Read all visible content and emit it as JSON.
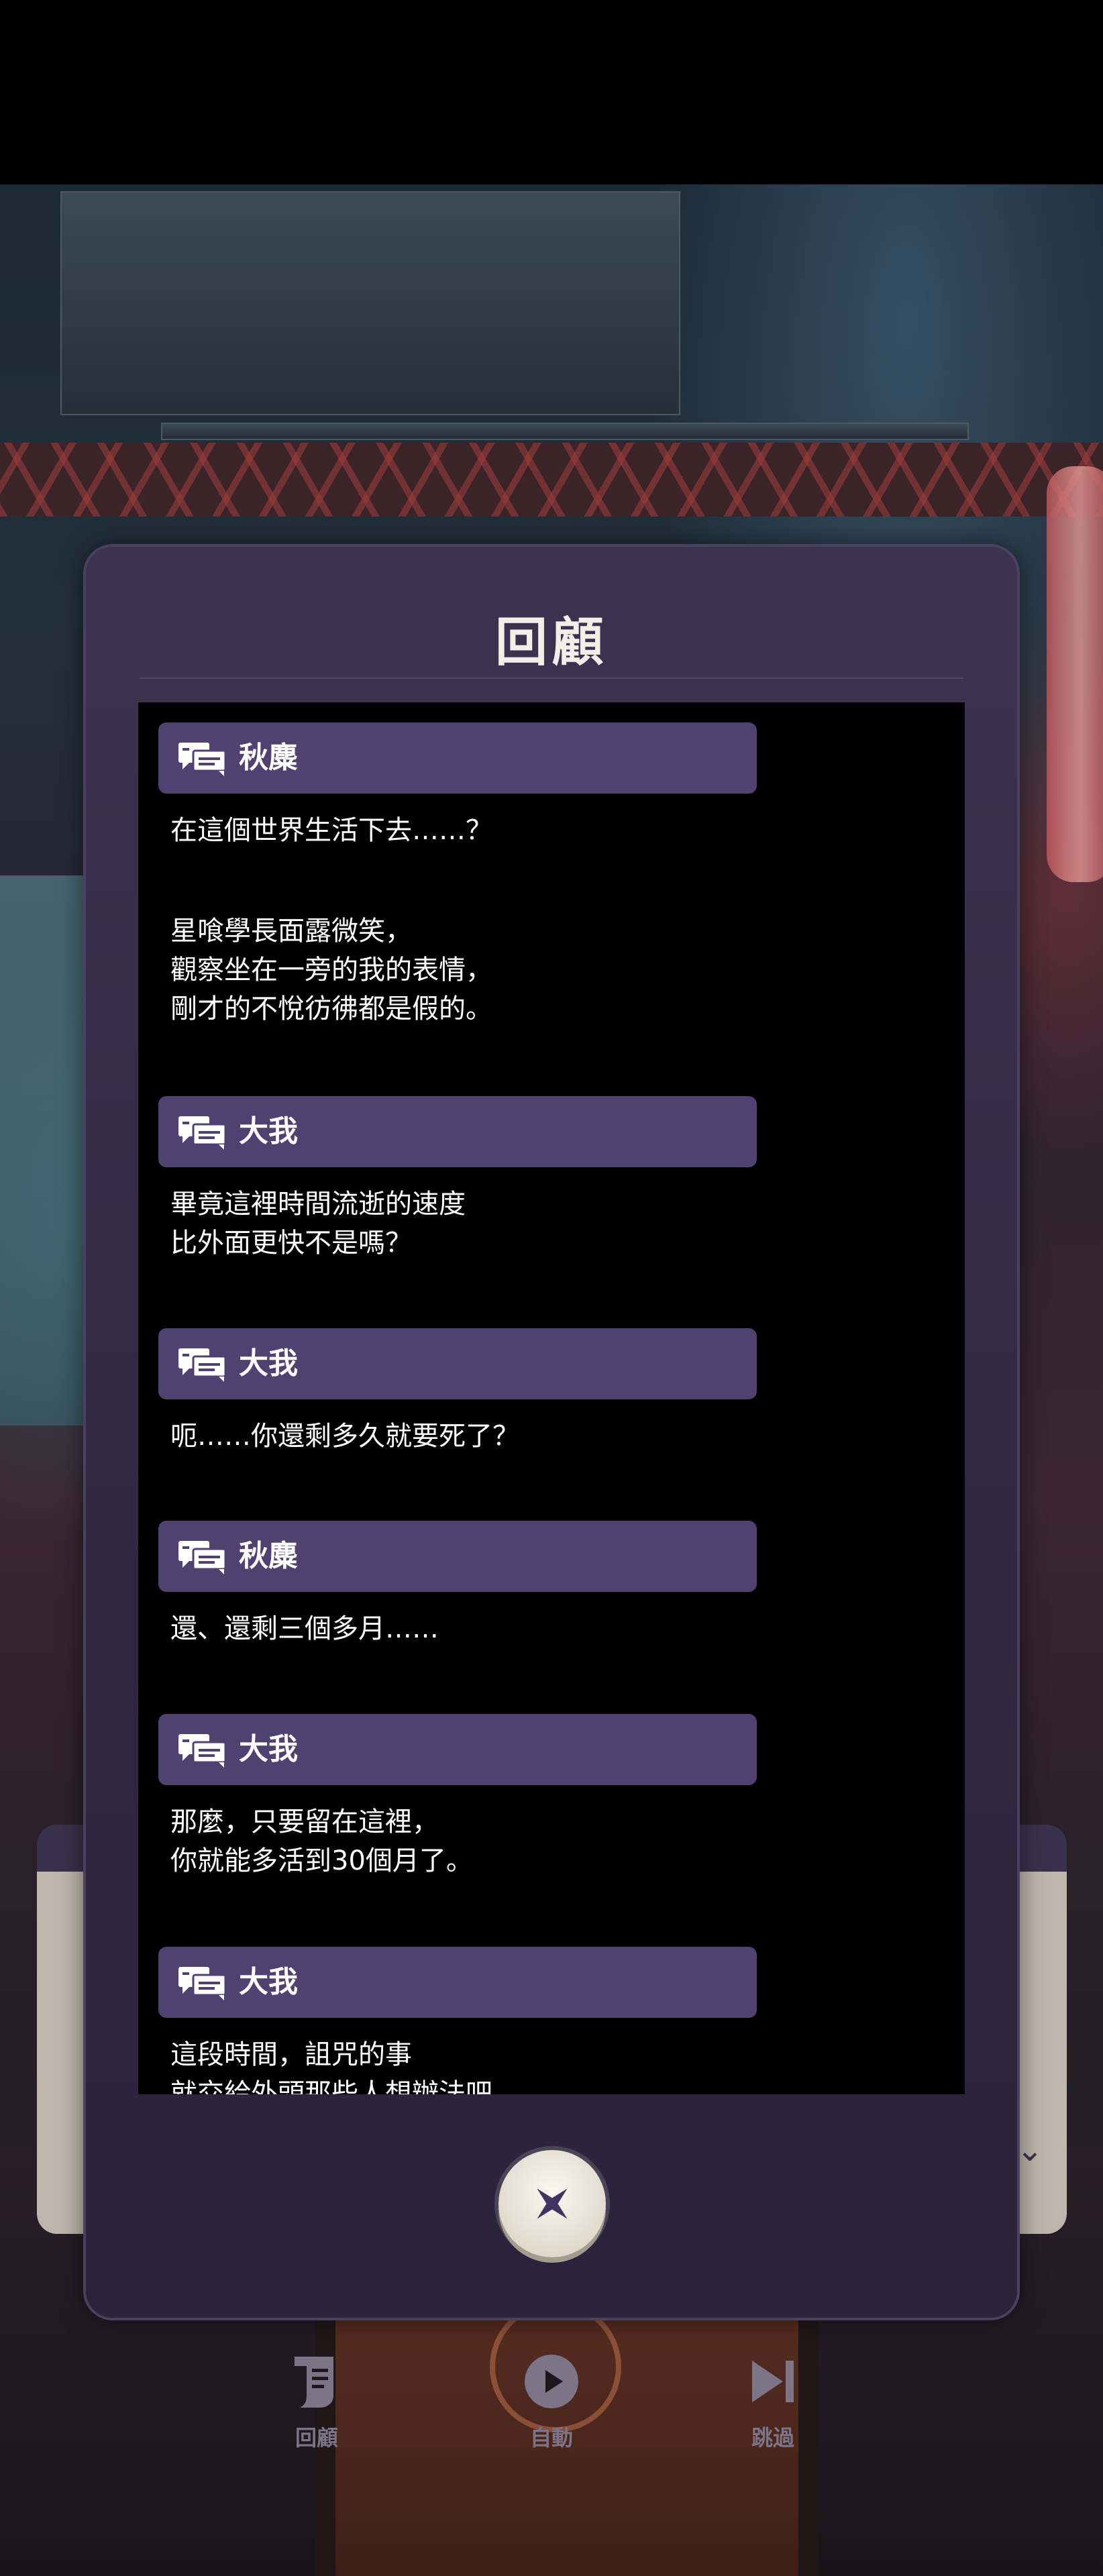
{
  "review": {
    "title": "回顧",
    "entries": [
      {
        "speaker": "秋麋",
        "text": "在這個世界生活下去……？"
      },
      {
        "speaker": "",
        "text": "星喰學長面露微笑，\n觀察坐在一旁的我的表情，\n剛才的不悅彷彿都是假的。"
      },
      {
        "speaker": "大我",
        "text": "畢竟這裡時間流逝的速度\n比外面更快不是嗎？"
      },
      {
        "speaker": "大我",
        "text": "呃……你還剩多久就要死了？"
      },
      {
        "speaker": "秋麋",
        "text": "還、還剩三個多月……"
      },
      {
        "speaker": "大我",
        "text": "那麼，只要留在這裡，\n你就能多活到30個月了。"
      },
      {
        "speaker": "大我",
        "text": "這段時間，詛咒的事\n就交給外頭那些人想辦法吧。"
      }
    ]
  },
  "icons": {
    "speaker": "speech-bubbles-icon",
    "close": "close-x-icon",
    "log": "scroll-icon",
    "auto": "play-circle-icon",
    "skip": "skip-forward-icon",
    "next": "chevron-down-icon"
  },
  "controls": {
    "log_label": "回顧",
    "auto_label": "自動",
    "skip_label": "跳過"
  },
  "colors": {
    "panel": "#2f2842",
    "speaker_bar": "#4f4270",
    "log_bg": "#000000",
    "text": "#ffffff"
  }
}
